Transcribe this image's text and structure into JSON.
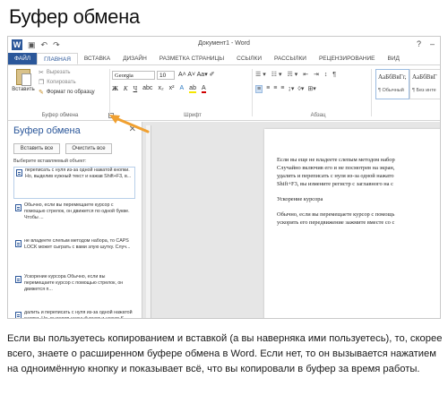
{
  "heading": "Буфер обмена",
  "window": {
    "doc_title": "Документ1 - Word",
    "logo_letter": "W"
  },
  "tabs": [
    {
      "label": "ФАЙЛ"
    },
    {
      "label": "ГЛАВНАЯ"
    },
    {
      "label": "ВСТАВКА"
    },
    {
      "label": "ДИЗАЙН"
    },
    {
      "label": "РАЗМЕТКА СТРАНИЦЫ"
    },
    {
      "label": "ССЫЛКИ"
    },
    {
      "label": "РАССЫЛКИ"
    },
    {
      "label": "РЕЦЕНЗИРОВАНИЕ"
    },
    {
      "label": "ВИД"
    }
  ],
  "ribbon": {
    "paste_label": "Вставить",
    "cut_label": "Вырезать",
    "copy_label": "Копировать",
    "format_painter_label": "Формат по образцу",
    "clipboard_group": "Буфер обмена",
    "font_group": "Шрифт",
    "paragraph_group": "Абзац",
    "font_name": "Georgia",
    "font_size": "10",
    "styles": [
      {
        "sample": "АаБбВвГг,",
        "name": "¶ Обычный"
      },
      {
        "sample": "АаБбВвГ",
        "name": "¶ Без инте"
      }
    ]
  },
  "pane": {
    "title": "Буфер обмена",
    "paste_all": "Вставить все",
    "clear_all": "Очистить все",
    "hint": "Выберите вставляемый объект:",
    "items": [
      {
        "text": "переписать с нуля из-за одной нажатой кнопки. Но, выделив нужный текст и нажав Shift+F3, в..."
      },
      {
        "text": "Обычно, если вы перемещаете курсор с помощью стрелок, он движется по одной букве. Чтобы ..."
      },
      {
        "text": "не владеете слепым методом набора, то CAPS LOCK может сыграть с вами злую шутку. Случ..."
      },
      {
        "text": "Ускорение курсора Обычно, если вы перемещаете курсор с помощью стрелок, он движется п..."
      },
      {
        "text": "далить и переписать с нуля из-за одной нажатой кнопки. Но, выделив нужный текст и нажав S..."
      }
    ]
  },
  "document": {
    "lines": [
      "Если вы еще не владеете слепым методом набор",
      "Случайно включив его и не посмотрев на экран,",
      "удалить и переписать с нуля из-за одной нажато",
      "Shift+F3, вы измените регистр с заглавного на с",
      "",
      "Ускорение курсора",
      "",
      "Обычно, если вы перемещаете курсор с помощь",
      "ускорить его передвижение зажмите вместе со с"
    ]
  },
  "caption": "Если вы пользуетесь копированием и вставкой (а вы наверняка ими пользуетесь), то, скорее всего, знаете о расширенном буфере обмена в Word. Если нет, то он вызывается нажатием на одноимённую кнопку и показывает всё, что вы копировали в буфер за время работы.",
  "colors": {
    "word_blue": "#2b579a",
    "arrow_orange": "#f0a030"
  }
}
